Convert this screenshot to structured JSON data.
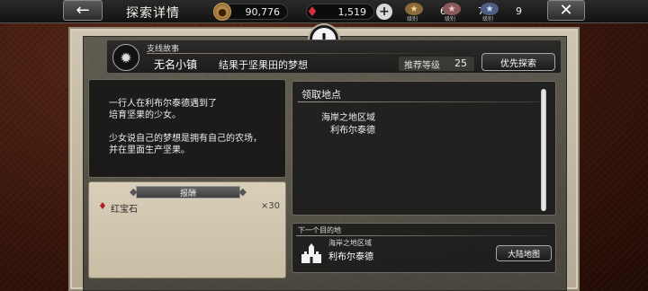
{
  "topbar": {
    "title": "探索详情",
    "back_icon": "arrow-left-icon",
    "close_icon": "close-icon",
    "gold": "90,776",
    "ruby": "1,519",
    "ranks": [
      {
        "label": "级别",
        "value": "6",
        "color": "#c9a46a"
      },
      {
        "label": "级别",
        "value": "7",
        "color": "#c98a8a"
      },
      {
        "label": "级别",
        "value": "9",
        "color": "#9fb3d9"
      }
    ]
  },
  "quest": {
    "type": "支线故事",
    "name": "无名小镇",
    "goal": "结果于坚果田的梦想",
    "recommend_label": "推荐等级",
    "recommend_value": "25",
    "priority_button": "优先探索"
  },
  "description": {
    "paragraph1_line1": "一行人在利布尔泰德遇到了",
    "paragraph1_line2": "培育坚果的少女。",
    "paragraph2_line1": "少女说自己的梦想是拥有自己的农场，",
    "paragraph2_line2": "并在里面生产坚果。"
  },
  "reward": {
    "title": "报酬",
    "item_name": "红宝石",
    "item_qty": "×30"
  },
  "location": {
    "title": "领取地点",
    "region": "海岸之地区域",
    "city": "利布尔泰德"
  },
  "next_destination": {
    "label": "下一个目的地",
    "region": "海岸之地区域",
    "city": "利布尔泰德",
    "map_button": "大陆地图"
  },
  "colors": {
    "ruby": "#d0303a",
    "panel_bg": "#cfc6b3",
    "dark_box": "#1c1c1c"
  }
}
